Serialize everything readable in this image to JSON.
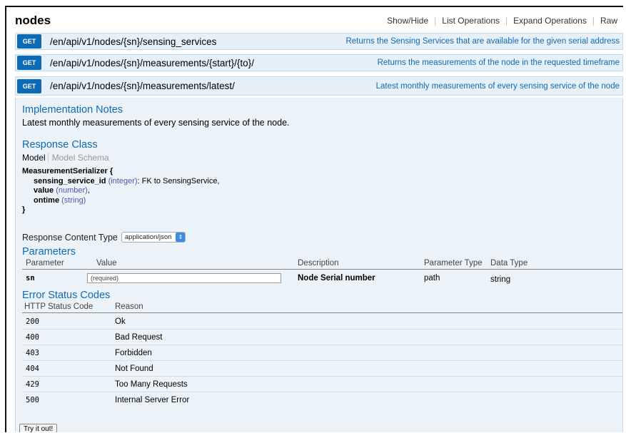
{
  "header": {
    "title": "nodes",
    "links": [
      "Show/Hide",
      "List Operations",
      "Expand Operations",
      "Raw"
    ]
  },
  "operations": [
    {
      "method": "GET",
      "path": "/en/api/v1/nodes/{sn}/sensing_services",
      "summary": "Returns the Sensing Services that are available for the given serial address"
    },
    {
      "method": "GET",
      "path": "/en/api/v1/nodes/{sn}/measurements/{start}/{to}/",
      "summary": "Returns the measurements of the node in the requested timeframe"
    },
    {
      "method": "GET",
      "path": "/en/api/v1/nodes/{sn}/measurements/latest/",
      "summary": "Latest monthly measurements of every sensing service of the node"
    }
  ],
  "implementation": {
    "heading": "Implementation Notes",
    "text": "Latest monthly measurements of every sensing service of the node."
  },
  "response_class": {
    "heading": "Response Class",
    "tab_model": "Model",
    "tab_schema": "Model Schema",
    "serializer": "MeasurementSerializer {",
    "fields": [
      {
        "name": "sensing_service_id",
        "type": "(integer)",
        "rest": ": FK to SensingService,"
      },
      {
        "name": "value",
        "type": "(number)",
        "rest": ","
      },
      {
        "name": "ontime",
        "type": "(string)",
        "rest": ""
      }
    ],
    "close": "}"
  },
  "response_content_type": {
    "label": "Response Content Type",
    "value": "application/json"
  },
  "parameters": {
    "heading": "Parameters",
    "columns": [
      "Parameter",
      "Value",
      "Description",
      "Parameter Type",
      "Data Type"
    ],
    "rows": [
      {
        "name": "sn",
        "placeholder": "(required)",
        "description": "Node Serial number",
        "param_type": "path",
        "data_type": "string"
      }
    ]
  },
  "errors": {
    "heading": "Error Status Codes",
    "columns": [
      "HTTP Status Code",
      "Reason"
    ],
    "rows": [
      {
        "code": "200",
        "reason": "Ok"
      },
      {
        "code": "400",
        "reason": "Bad Request"
      },
      {
        "code": "403",
        "reason": "Forbidden"
      },
      {
        "code": "404",
        "reason": "Not Found"
      },
      {
        "code": "429",
        "reason": "Too Many Requests"
      },
      {
        "code": "500",
        "reason": "Internal Server Error"
      }
    ]
  },
  "try_button": "Try it out!"
}
